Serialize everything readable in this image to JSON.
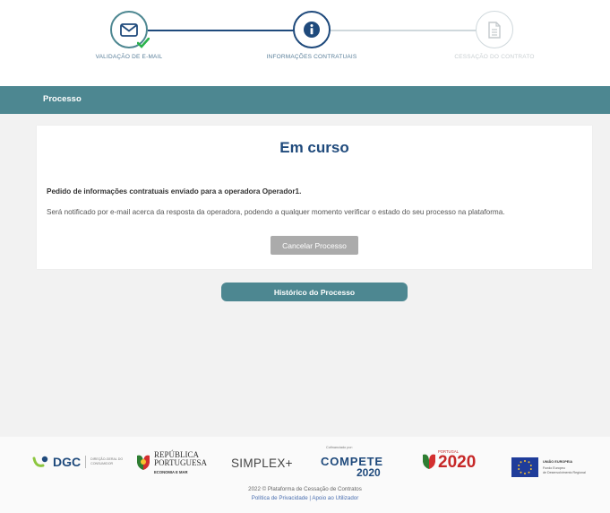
{
  "stepper": {
    "steps": [
      {
        "label": "VALIDAÇÃO DE E-MAIL",
        "icon": "envelope-icon",
        "state": "done"
      },
      {
        "label": "INFORMAÇÕES CONTRATUAIS",
        "icon": "info-icon",
        "state": "active"
      },
      {
        "label": "CESSAÇÃO DO CONTRATO",
        "icon": "document-icon",
        "state": "pending"
      }
    ]
  },
  "banner": {
    "title": "Processo"
  },
  "card": {
    "title": "Em curso",
    "message_bold": "Pedido de informações contratuais enviado para a operadora Operador1.",
    "message": "Será notificado por e-mail acerca da resposta da operadora, podendo a qualquer momento verificar o estado do seu processo na plataforma.",
    "cancel_button": "Cancelar Processo"
  },
  "history_button": "Histórico do Processo",
  "footer": {
    "logos": {
      "dgc": "DGC",
      "dgc_sub": "DIREÇÃO-GERAL DO CONSUMIDOR",
      "republica_1": "REPÚBLICA",
      "republica_2": "PORTUGUESA",
      "republica_sub": "ECONOMIA E MAR",
      "simplex": "SIMPLEX+",
      "compete_top": "Cofinanciado por:",
      "compete": "COMPETE",
      "compete_year": "2020",
      "portugal_top": "PORTUGAL",
      "portugal_year": "2020",
      "eu_title": "UNIÃO EUROPEIA",
      "eu_sub_1": "Fundo Europeu",
      "eu_sub_2": "de Desenvolvimento Regional"
    },
    "copyright": "2022 © Plataforma de Cessação de Contratos",
    "links": "Política de Privacidade | Apoio ao Utilizador"
  },
  "colors": {
    "accent": "#4d8791",
    "title": "#1f4a7c",
    "check": "#2bb24c"
  }
}
